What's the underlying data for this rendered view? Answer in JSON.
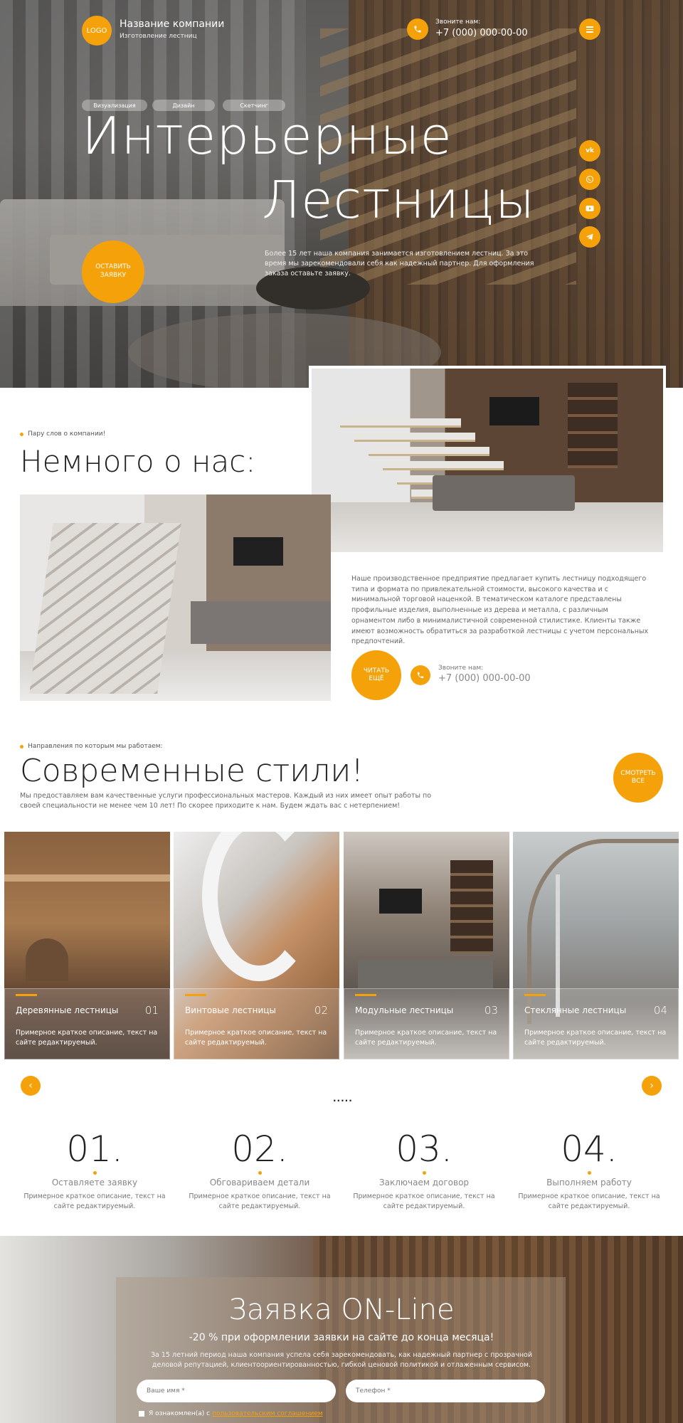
{
  "header": {
    "logo_text": "LOGO",
    "company_name": "Название компании",
    "company_tagline": "Изготовление лестниц",
    "call_label": "Звоните нам:",
    "phone": "+7 (000) 000-00-00"
  },
  "hero": {
    "tags": [
      "Визуализация",
      "Дизайн",
      "Скетчинг"
    ],
    "title_line1": "Интерьерные",
    "title_line2": "Лестницы",
    "description": "Более 15 лет наша компания занимается изготовлением лестниц. За это время мы зарекомендовали себя как надежный партнер. Для оформления заказа оставьте заявку.",
    "cta_label": "ОСТАВИТЬ ЗАЯВКУ",
    "socials": [
      "vk",
      "whatsapp",
      "youtube",
      "telegram"
    ]
  },
  "about": {
    "eyebrow": "Пару слов о компании!",
    "title": "Немного о нас:",
    "text": "Наше производственное предприятие предлагает купить лестницу подходящего типа и формата по привлекательной стоимости, высокого качества и с минимальной торговой наценкой. В тематическом каталоге представлены профильные изделия, выполненные из дерева и металла, с различным орнаментом либо в минималистичной современной стилистике. Клиенты также имеют возможность обратиться за разработкой лестницы с учетом персональных предпочтений.",
    "read_more_label": "ЧИТАТЬ ЕЩЁ",
    "call_label": "Звоните нам:",
    "phone": "+7 (000) 000-00-00"
  },
  "styles": {
    "eyebrow": "Направления по которым мы работаем:",
    "title": "Современные стили!",
    "description": "Мы предоставляем вам качественные услуги профессиональных мастеров. Каждый из них имеет опыт работы по своей специальности не менее чем 10 лет! По скорее приходите к нам. Будем ждать вас с нетерпением!",
    "see_all_label": "СМОТРЕТЬ ВСЕ",
    "cards": [
      {
        "title": "Деревянные лестницы",
        "num": "01",
        "desc": "Примерное краткое описание, текст на сайте редактируемый."
      },
      {
        "title": "Винтовые лестницы",
        "num": "02",
        "desc": "Примерное краткое описание, текст на сайте редактируемый."
      },
      {
        "title": "Модульные лестницы",
        "num": "03",
        "desc": "Примерное краткое описание, текст на сайте редактируемый."
      },
      {
        "title": "Стеклянные лестницы",
        "num": "04",
        "desc": "Примерное краткое описание, текст на сайте редактируемый."
      }
    ],
    "dots": "....."
  },
  "steps": [
    {
      "num": "01.",
      "title": "Оставляете заявку",
      "desc": "Примерное краткое описание, текст на сайте редактируемый."
    },
    {
      "num": "02.",
      "title": "Обговариваем детали",
      "desc": "Примерное краткое описание, текст на сайте редактируемый."
    },
    {
      "num": "03.",
      "title": "Заключаем договор",
      "desc": "Примерное краткое описание, текст на сайте редактируемый."
    },
    {
      "num": "04.",
      "title": "Выполняем работу",
      "desc": "Примерное краткое описание, текст на сайте редактируемый."
    }
  ],
  "form": {
    "title": "Заявка ON-Line",
    "subtitle": "-20 % при оформлении заявки на сайте до конца месяца!",
    "text": "За 15 летний период наша компания успела себя зарекомендовать, как надежный партнер с прозрачной деловой репутацией, клиентоориентированностью, гибкой ценовой политикой и отлаженным сервисом.",
    "name_placeholder": "Ваше имя *",
    "phone_placeholder": "Телефон *",
    "agree_text": "Я ознакомлен(а) с",
    "agree_link": "пользовательским соглашением"
  },
  "colors": {
    "accent": "#f5a20a"
  }
}
